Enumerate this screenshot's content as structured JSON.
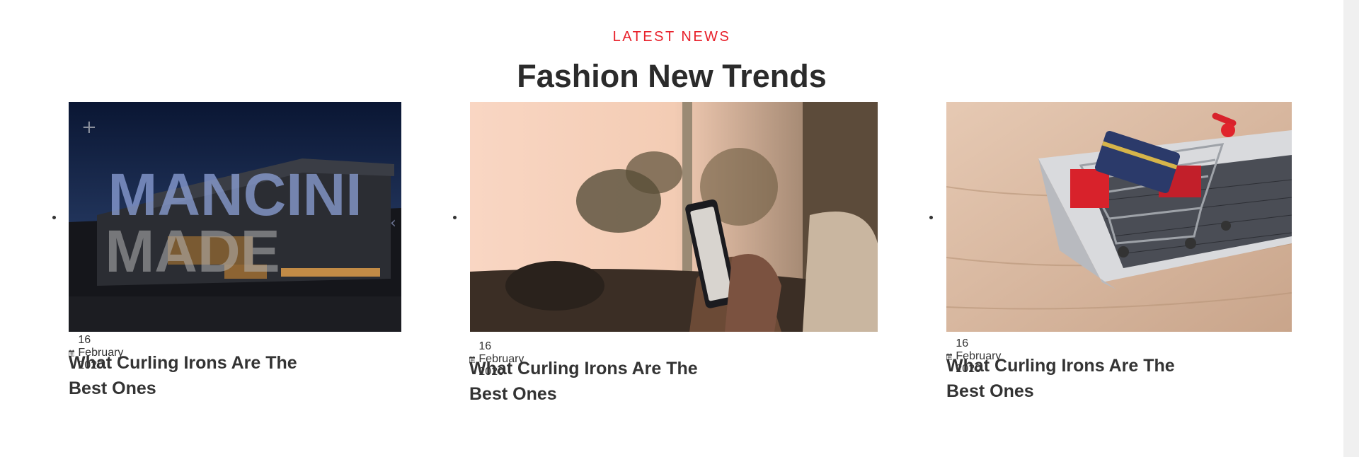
{
  "section": {
    "eyebrow": "LATEST NEWS",
    "heading": "Fashion New Trends",
    "accent_color": "#e8212b"
  },
  "posts": [
    {
      "image_icon": "architecture-photo",
      "logo_text_line1": "MANCINI",
      "logo_text_line2": "MADE",
      "date_icon": "calendar-icon",
      "date": "16 February 2020",
      "title": "What Curling Irons Are The Best Ones"
    },
    {
      "image_icon": "phone-on-couch-photo",
      "date_icon": "calendar-icon",
      "date": "16 February 2020",
      "title": "What Curling Irons Are The Best Ones"
    },
    {
      "image_icon": "shopping-cart-laptop-photo",
      "date_icon": "calendar-icon",
      "date": "16 February 2020",
      "title": "What Curling Irons Are The Best Ones"
    }
  ]
}
